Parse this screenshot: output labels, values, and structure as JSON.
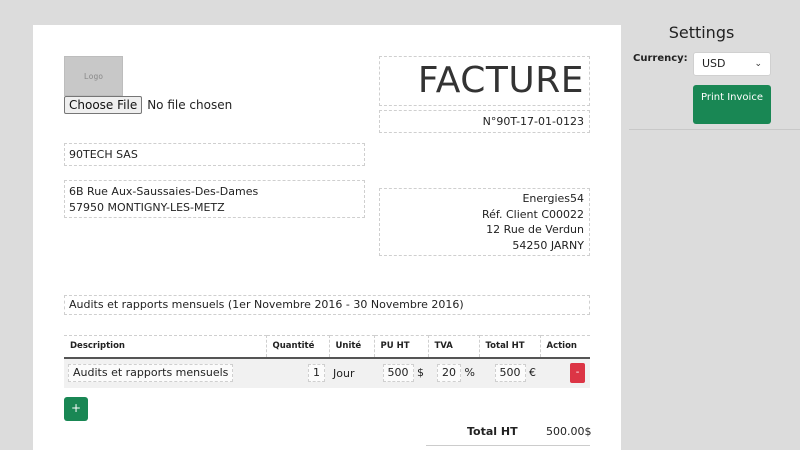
{
  "invoice": {
    "logo_text": "Logo",
    "file_button": "Choose File",
    "file_status": "No file chosen",
    "title": "FACTURE",
    "number": "N°90T-17-01-0123",
    "company_name": "90TECH SAS",
    "company_address_line1": "6B Rue Aux-Saussaies-Des-Dames",
    "company_address_line2": "57950 MONTIGNY-LES-METZ",
    "client_line1": "Energies54",
    "client_line2": "Réf. Client C00022",
    "client_line3": "12 Rue de Verdun",
    "client_line4": "54250 JARNY",
    "subject": "Audits et rapports mensuels (1er Novembre 2016 - 30 Novembre 2016)"
  },
  "table": {
    "headers": [
      "Description",
      "Quantité",
      "Unité",
      "PU HT",
      "TVA",
      "Total HT",
      "Action"
    ],
    "rows": [
      {
        "description": "Audits et rapports mensuels",
        "quantity": "1",
        "unit": "Jour",
        "unit_price": "500",
        "unit_price_currency": "$",
        "tva": "20",
        "tva_unit": "%",
        "total": "500",
        "total_currency": "€",
        "delete_label": "-"
      }
    ],
    "add_label": "+"
  },
  "totals": {
    "label": "Total HT",
    "value": "500.00$"
  },
  "settings": {
    "title": "Settings",
    "currency_label": "Currency:",
    "currency_value": "USD",
    "print_label": "Print Invoice"
  },
  "colors": {
    "accent_green": "#198754",
    "danger_red": "#dc3545"
  }
}
